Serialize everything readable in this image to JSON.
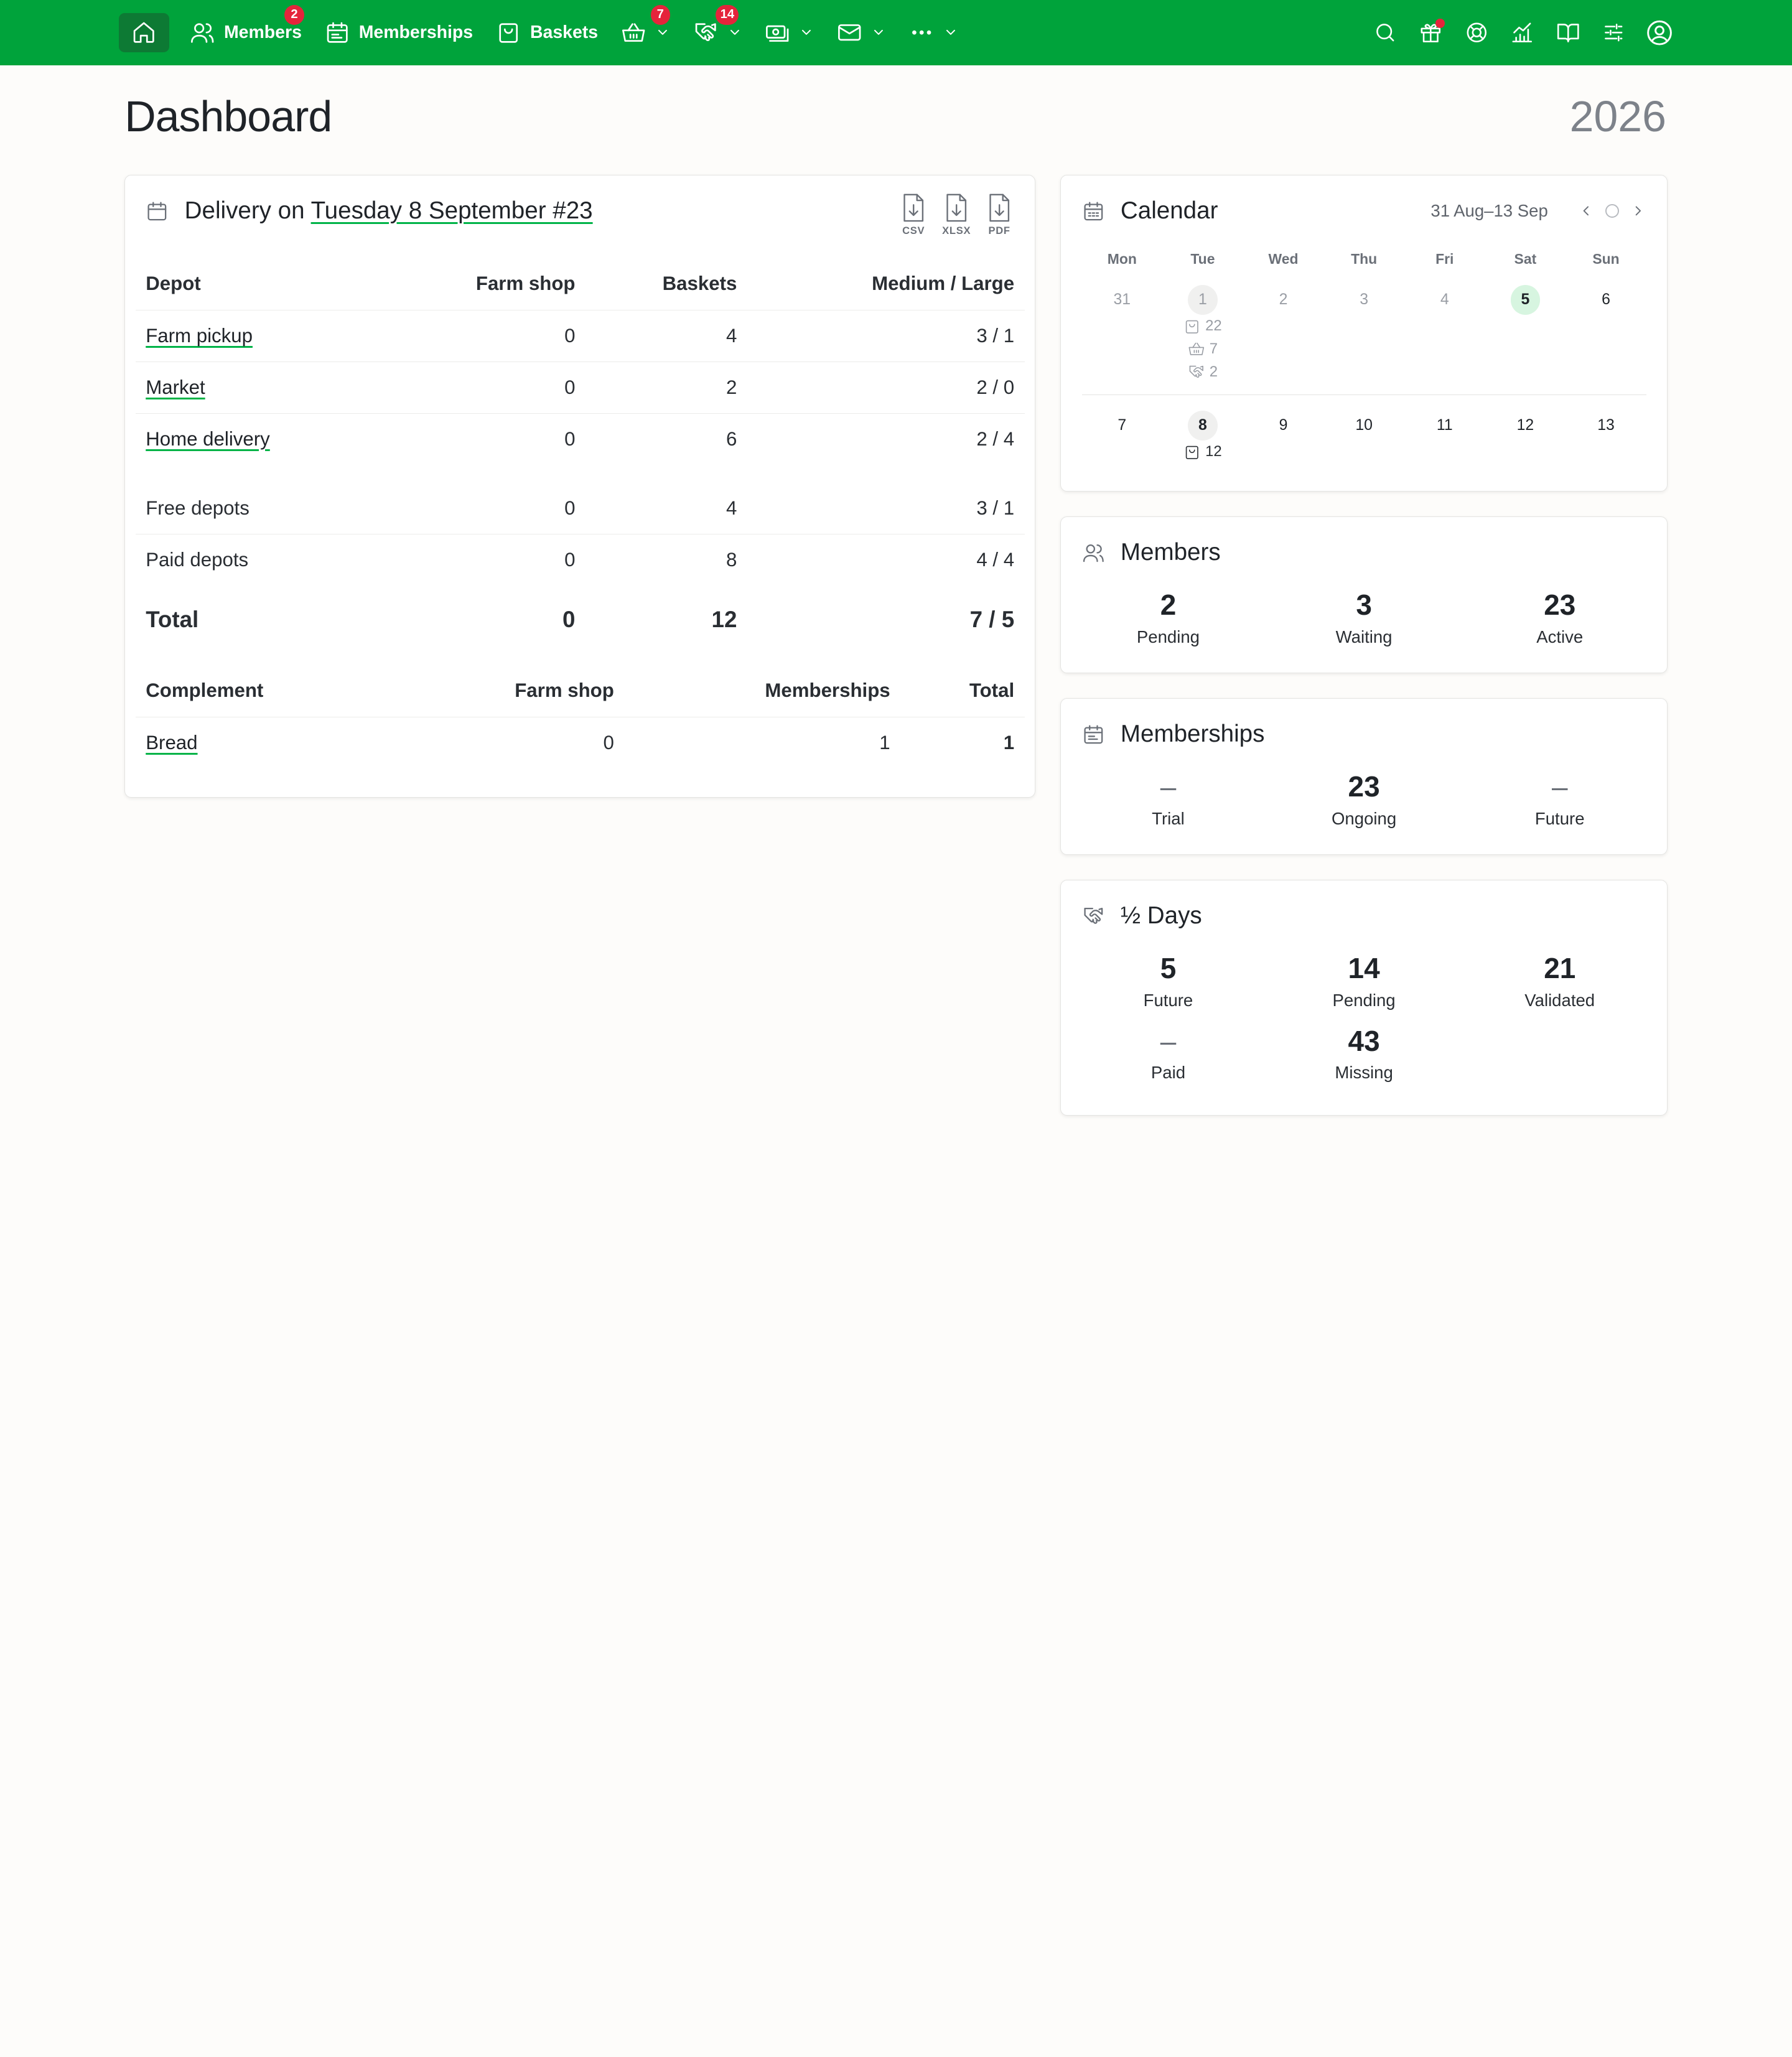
{
  "nav": {
    "members_label": "Members",
    "members_badge": "2",
    "memberships_label": "Memberships",
    "baskets_label": "Baskets",
    "basket_menu_badge": "7",
    "halfday_menu_badge": "14"
  },
  "header": {
    "title": "Dashboard",
    "year": "2026"
  },
  "delivery": {
    "title_prefix": "Delivery on ",
    "title_link": "Tuesday 8 September #23",
    "exports": [
      "CSV",
      "XLSX",
      "PDF"
    ],
    "columns": [
      "Depot",
      "Farm shop",
      "Baskets",
      "Medium / Large"
    ],
    "depots": [
      {
        "name": "Farm pickup",
        "farm_shop": "0",
        "baskets": "4",
        "sizes": "3 / 1"
      },
      {
        "name": "Market",
        "farm_shop": "0",
        "baskets": "2",
        "sizes": "2 / 0"
      },
      {
        "name": "Home delivery",
        "farm_shop": "0",
        "baskets": "6",
        "sizes": "2 / 4"
      }
    ],
    "groups": [
      {
        "name": "Free depots",
        "farm_shop": "0",
        "baskets": "4",
        "sizes": "3 / 1"
      },
      {
        "name": "Paid depots",
        "farm_shop": "0",
        "baskets": "8",
        "sizes": "4 / 4"
      }
    ],
    "total": {
      "name": "Total",
      "farm_shop": "0",
      "baskets": "12",
      "sizes": "7 / 5"
    },
    "complement_columns": [
      "Complement",
      "Farm shop",
      "Memberships",
      "Total"
    ],
    "complements": [
      {
        "name": "Bread",
        "farm_shop": "0",
        "memberships": "1",
        "total": "1"
      }
    ]
  },
  "calendar": {
    "title": "Calendar",
    "range": "31 Aug–13 Sep",
    "dow": [
      "Mon",
      "Tue",
      "Wed",
      "Thu",
      "Fri",
      "Sat",
      "Sun"
    ],
    "week1": [
      "31",
      "1",
      "2",
      "3",
      "4",
      "5",
      "6"
    ],
    "week1_stats": {
      "baskets": "22",
      "shop": "7",
      "halfdays": "2"
    },
    "week2": [
      "7",
      "8",
      "9",
      "10",
      "11",
      "12",
      "13"
    ],
    "week2_stats": {
      "baskets": "12"
    }
  },
  "members": {
    "title": "Members",
    "items": [
      {
        "value": "2",
        "label": "Pending"
      },
      {
        "value": "3",
        "label": "Waiting"
      },
      {
        "value": "23",
        "label": "Active"
      }
    ]
  },
  "memberships": {
    "title": "Memberships",
    "items": [
      {
        "value": "–",
        "label": "Trial"
      },
      {
        "value": "23",
        "label": "Ongoing"
      },
      {
        "value": "–",
        "label": "Future"
      }
    ]
  },
  "halfdays": {
    "title": "½ Days",
    "items": [
      {
        "value": "5",
        "label": "Future"
      },
      {
        "value": "14",
        "label": "Pending"
      },
      {
        "value": "21",
        "label": "Validated"
      },
      {
        "value": "–",
        "label": "Paid"
      },
      {
        "value": "43",
        "label": "Missing"
      }
    ]
  },
  "colors": {
    "brand": "#00a33b",
    "badge": "#e5243b",
    "today": "#d7f5e0"
  }
}
